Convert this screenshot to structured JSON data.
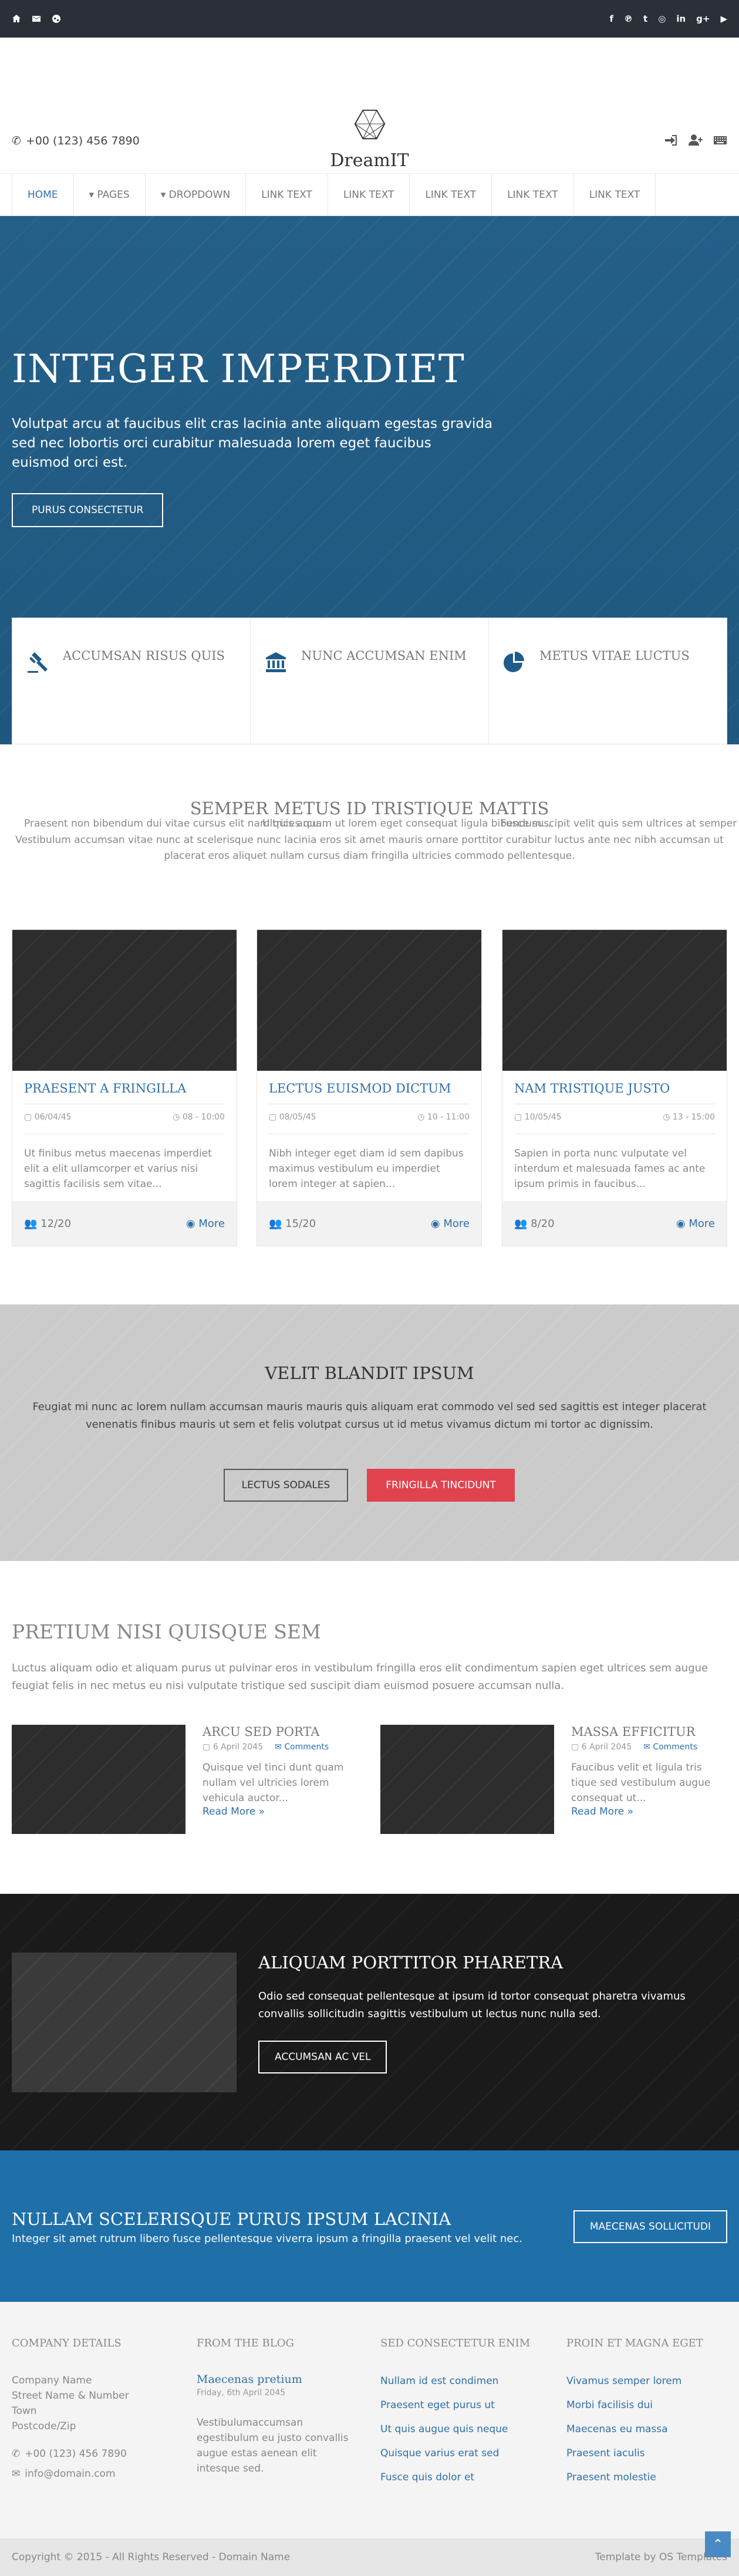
{
  "topbar": {
    "left_icons": [
      "home-icon",
      "mail-icon",
      "globe-icon"
    ],
    "social": [
      {
        "name": "facebook-icon",
        "glyph": "f"
      },
      {
        "name": "pinterest-icon",
        "glyph": "℗"
      },
      {
        "name": "twitter-icon",
        "glyph": "t"
      },
      {
        "name": "dribbble-icon",
        "glyph": "◎"
      },
      {
        "name": "linkedin-icon",
        "glyph": "in"
      },
      {
        "name": "googleplus-icon",
        "glyph": "g+"
      },
      {
        "name": "share-icon",
        "glyph": "▶"
      }
    ]
  },
  "header": {
    "phone": "+00 (123) 456 7890",
    "brand": "DreamIT",
    "right_icons": [
      "sign-in-icon",
      "user-add-icon",
      "keyboard-icon"
    ]
  },
  "nav": {
    "items": [
      {
        "label": "HOME",
        "active": true
      },
      {
        "label": "▾ PAGES"
      },
      {
        "label": "▾ DROPDOWN"
      },
      {
        "label": "LINK TEXT"
      },
      {
        "label": "LINK TEXT"
      },
      {
        "label": "LINK TEXT"
      },
      {
        "label": "LINK TEXT"
      },
      {
        "label": "LINK TEXT"
      }
    ]
  },
  "hero": {
    "title": "INTEGER IMPERDIET",
    "text": "Volutpat arcu at faucibus elit cras lacinia ante aliquam egestas gravida sed nec lobortis orci curabitur malesuada lorem eget faucibus euismod orci est.",
    "button": "PURUS CONSECTETUR",
    "features": [
      {
        "icon": "gavel-icon",
        "title": "ACCUMSAN RISUS QUIS",
        "text": "Praesent non bibendum dui vitae cursus elit nam quis arcu..."
      },
      {
        "icon": "bank-icon",
        "title": "NUNC ACCUMSAN ENIM",
        "text": "Ultrices quam ut lorem eget consequat ligula bibendum..."
      },
      {
        "icon": "pie-chart-icon",
        "title": "METUS VITAE LUCTUS",
        "text": "Fusce suscipit velit quis sem ultrices at semper nisi..."
      }
    ]
  },
  "intro": {
    "title": "SEMPER METUS ID TRISTIQUE MATTIS",
    "text": "Vestibulum accumsan vitae nunc at scelerisque nunc lacinia eros sit amet mauris ornare porttitor curabitur luctus ante nec nibh accumsan ut placerat eros aliquet nullam cursus diam fringilla ultricies commodo pellentesque."
  },
  "cards": [
    {
      "title": "PRAESENT A FRINGILLA",
      "date": "06/04/45",
      "time": "08 - 10:00",
      "text": "Ut finibus metus maecenas imperdiet elit a elit ullamcorper et varius nisi sagittis facilisis sem vitae...",
      "count": "12/20",
      "more": "More"
    },
    {
      "title": "LECTUS EUISMOD DICTUM",
      "date": "08/05/45",
      "time": "10 - 11:00",
      "text": "Nibh integer eget diam id sem dapibus maximus vestibulum eu imperdiet lorem integer at sapien...",
      "count": "15/20",
      "more": "More"
    },
    {
      "title": "NAM TRISTIQUE JUSTO",
      "date": "10/05/45",
      "time": "13 - 15:00",
      "text": "Sapien in porta nunc vulputate vel interdum et malesuada fames ac ante ipsum primis in faucibus...",
      "count": "8/20",
      "more": "More"
    }
  ],
  "grey": {
    "title": "VELIT BLANDIT IPSUM",
    "text": "Feugiat mi nunc ac lorem nullam accumsan mauris mauris quis aliquam erat commodo vel sed sed sagittis est integer placerat venenatis finibus mauris ut sem et felis volutpat cursus ut id metus vivamus dictum mi tortor ac dignissim.",
    "btn1": "LECTUS SODALES",
    "btn2": "FRINGILLA TINCIDUNT"
  },
  "blog": {
    "title": "PRETIUM NISI QUISQUE SEM",
    "text": "Luctus aliquam odio et aliquam purus ut pulvinar eros in vestibulum fringilla eros elit condimentum sapien eget ultrices sem augue feugiat felis in nec metus eu nisi vulputate tristique sed suscipit diam euismod posuere accumsan nulla.",
    "posts": [
      {
        "title": "ARCU SED PORTA",
        "date": "6 April 2045",
        "comments": "Comments",
        "text": "Quisque vel tinci dunt quam nullam vel ultricies lorem vehicula auctor...",
        "readmore": "Read More »"
      },
      {
        "title": "MASSA EFFICITUR",
        "date": "6 April 2045",
        "comments": "Comments",
        "text": "Faucibus velit et ligula tris tique sed vestibulum augue consequat ut...",
        "readmore": "Read More »"
      }
    ]
  },
  "dark": {
    "title": "ALIQUAM PORTTITOR PHARETRA",
    "text": "Odio sed consequat pellentesque at ipsum id tortor consequat pharetra vivamus convallis sollicitudin sagittis vestibulum ut lectus nunc nulla sed.",
    "button": "ACCUMSAN AC VEL"
  },
  "cta": {
    "title": "NULLAM SCELERISQUE PURUS IPSUM LACINIA",
    "text": "Integer sit amet rutrum libero fusce pellentesque viverra ipsum a fringilla praesent vel velit nec.",
    "button": "MAECENAS SOLLICITUDI"
  },
  "footer": {
    "company": {
      "title": "COMPANY DETAILS",
      "lines": [
        "Company Name",
        "Street Name & Number",
        "Town",
        "Postcode/Zip"
      ],
      "phone": "+00 (123) 456 7890",
      "email": "info@domain.com"
    },
    "blog": {
      "title": "FROM THE BLOG",
      "post_title": "Maecenas pretium",
      "post_date": "Friday, 6th April 2045",
      "post_text": "Vestibulumaccumsan egestibulum eu justo convallis augue estas aenean elit intesque sed."
    },
    "links1": {
      "title": "SED CONSECTETUR ENIM",
      "items": [
        "Nullam id est condimen",
        "Praesent eget purus ut",
        "Ut quis augue quis neque",
        "Quisque varius erat sed",
        "Fusce quis dolor et"
      ]
    },
    "links2": {
      "title": "PROIN ET MAGNA EGET",
      "items": [
        "Vivamus semper lorem",
        "Morbi facilisis dui",
        "Maecenas eu massa",
        "Praesent iaculis",
        "Praesent molestie"
      ]
    }
  },
  "bottom": {
    "copyright": "Copyright © 2015 - All Rights Reserved - Domain Name",
    "credit": "Template by OS Templates",
    "totop_glyph": "⌃"
  },
  "colors": {
    "topbar": "#2b2f38",
    "accent": "#2f6fa8",
    "hero": "#215b84",
    "danger": "#e0434d",
    "cta": "#1f6fa8"
  }
}
